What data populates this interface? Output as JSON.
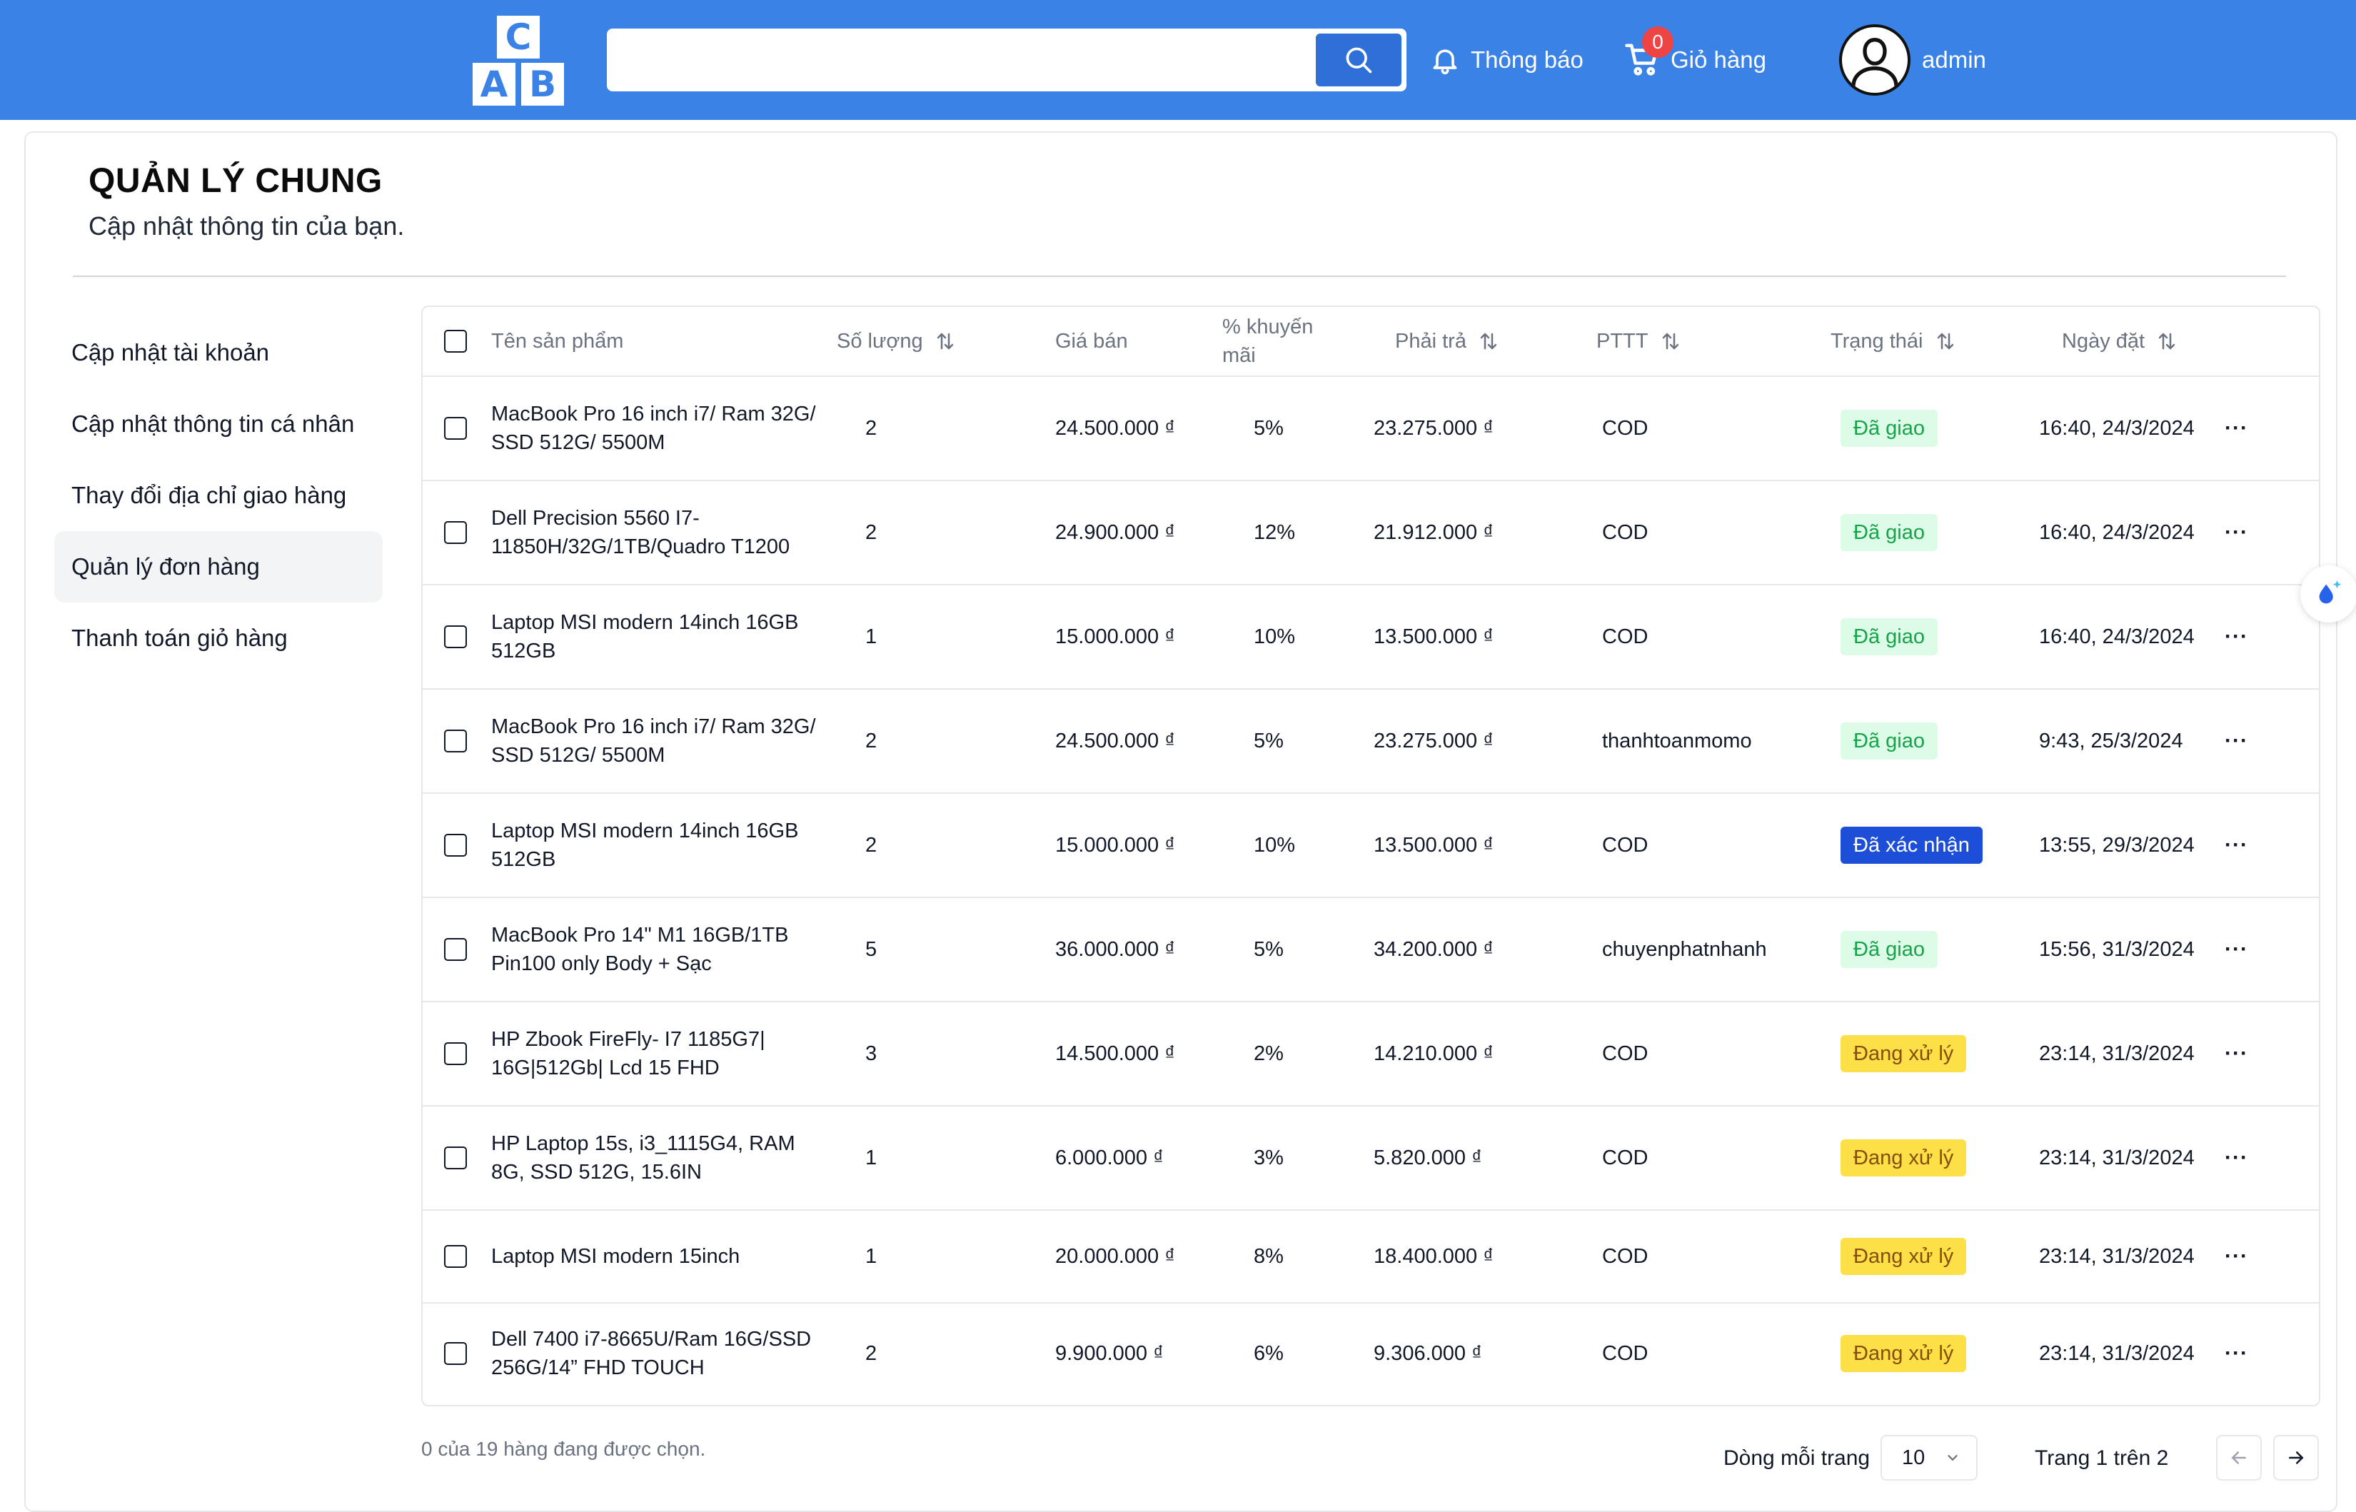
{
  "header": {
    "logo_letters": {
      "top": "C",
      "left": "A",
      "right": "B"
    },
    "search": {
      "value": "",
      "placeholder": ""
    },
    "notify_label": "Thông báo",
    "cart_label": "Giỏ hàng",
    "cart_count": "0",
    "user_name": "admin",
    "colors": {
      "bar": "#3b82e6",
      "search_button": "#2f6fd8",
      "badge": "#ef4444"
    }
  },
  "page": {
    "title": "QUẢN LÝ CHUNG",
    "subtitle": "Cập nhật thông tin của bạn."
  },
  "sidebar": {
    "items": [
      {
        "label": "Cập nhật tài khoản",
        "active": false
      },
      {
        "label": "Cập nhật thông tin cá nhân",
        "active": false
      },
      {
        "label": "Thay đổi địa chỉ giao hàng",
        "active": false
      },
      {
        "label": "Quản lý đơn hàng",
        "active": true
      },
      {
        "label": "Thanh toán giỏ hàng",
        "active": false
      }
    ]
  },
  "table": {
    "headers": {
      "name": "Tên sản phẩm",
      "qty": "Số lượng",
      "price": "Giá bán",
      "discount_line1": "% khuyến",
      "discount_line2": "mãi",
      "pay": "Phải trả",
      "method": "PTTT",
      "status": "Trạng thái",
      "date": "Ngày đặt"
    },
    "rows": [
      {
        "name": "MacBook Pro 16 inch i7/ Ram 32G/ SSD 512G/ 5500M",
        "qty": "2",
        "price": "24.500.000 ₫",
        "discount": "5%",
        "pay": "23.275.000 ₫",
        "method": "COD",
        "status": "Đã giao",
        "status_kind": "green",
        "date": "16:40, 24/3/2024"
      },
      {
        "name": "Dell Precision 5560 I7-11850H/32G/1TB/Quadro T1200",
        "qty": "2",
        "price": "24.900.000 ₫",
        "discount": "12%",
        "pay": "21.912.000 ₫",
        "method": "COD",
        "status": "Đã giao",
        "status_kind": "green",
        "date": "16:40, 24/3/2024"
      },
      {
        "name": "Laptop MSI modern 14inch 16GB 512GB",
        "qty": "1",
        "price": "15.000.000 ₫",
        "discount": "10%",
        "pay": "13.500.000 ₫",
        "method": "COD",
        "status": "Đã giao",
        "status_kind": "green",
        "date": "16:40, 24/3/2024"
      },
      {
        "name": "MacBook Pro 16 inch i7/ Ram 32G/ SSD 512G/ 5500M",
        "qty": "2",
        "price": "24.500.000 ₫",
        "discount": "5%",
        "pay": "23.275.000 ₫",
        "method": "thanhtoanmomo",
        "status": "Đã giao",
        "status_kind": "green",
        "date": "9:43, 25/3/2024"
      },
      {
        "name": "Laptop MSI modern 14inch 16GB 512GB",
        "qty": "2",
        "price": "15.000.000 ₫",
        "discount": "10%",
        "pay": "13.500.000 ₫",
        "method": "COD",
        "status": "Đã xác nhận",
        "status_kind": "blue",
        "date": "13:55, 29/3/2024"
      },
      {
        "name": "MacBook Pro 14\" M1 16GB/1TB Pin100 only Body + Sạc",
        "qty": "5",
        "price": "36.000.000 ₫",
        "discount": "5%",
        "pay": "34.200.000 ₫",
        "method": "chuyenphatnhanh",
        "status": "Đã giao",
        "status_kind": "green",
        "date": "15:56, 31/3/2024"
      },
      {
        "name": "HP Zbook FireFly- I7 1185G7| 16G|512Gb| Lcd 15 FHD",
        "qty": "3",
        "price": "14.500.000 ₫",
        "discount": "2%",
        "pay": "14.210.000 ₫",
        "method": "COD",
        "status": "Đang xử lý",
        "status_kind": "yellow",
        "date": "23:14, 31/3/2024"
      },
      {
        "name": "HP Laptop 15s, i3_1115G4, RAM 8G, SSD 512G, 15.6IN",
        "qty": "1",
        "price": "6.000.000 ₫",
        "discount": "3%",
        "pay": "5.820.000 ₫",
        "method": "COD",
        "status": "Đang xử lý",
        "status_kind": "yellow",
        "date": "23:14, 31/3/2024"
      },
      {
        "name": "Laptop MSI modern 15inch",
        "qty": "1",
        "price": "20.000.000 ₫",
        "discount": "8%",
        "pay": "18.400.000 ₫",
        "method": "COD",
        "status": "Đang xử lý",
        "status_kind": "yellow",
        "date": "23:14, 31/3/2024"
      },
      {
        "name": "Dell 7400 i7-8665U/Ram 16G/SSD 256G/14” FHD TOUCH",
        "qty": "2",
        "price": "9.900.000 ₫",
        "discount": "6%",
        "pay": "9.306.000 ₫",
        "method": "COD",
        "status": "Đang xử lý",
        "status_kind": "yellow",
        "date": "23:14, 31/3/2024"
      }
    ],
    "row_actions_icon": "ellipsis-icon"
  },
  "footer": {
    "selection_text": "0 của 19 hàng đang được chọn.",
    "rows_per_page_label": "Dòng mỗi trang",
    "rows_per_page_value": "10",
    "page_info": "Trang 1 trên 2"
  },
  "icons": {
    "search": "search-icon",
    "notify": "bell-icon",
    "cart": "cart-icon",
    "user": "user-avatar-icon",
    "sort": "sort-arrows-icon",
    "prev": "arrow-left-icon",
    "next": "arrow-right-icon",
    "float": "water-drop-sparkle-icon"
  },
  "status_colors": {
    "green_bg": "#dcfce7",
    "green_fg": "#16a34a",
    "blue_bg": "#1d4ed8",
    "yellow_bg": "#fde047"
  }
}
